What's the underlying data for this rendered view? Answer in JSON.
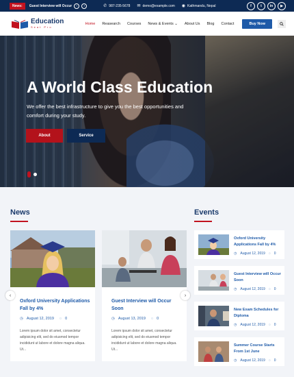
{
  "topbar": {
    "news_label": "News:",
    "ticker": "Guest Interview will Occur",
    "phone": "987-235-5678",
    "email": "demo@example.com",
    "location": "Kathmandu, Nepal"
  },
  "header": {
    "logo_title": "Education",
    "logo_sub": "Seat Pro",
    "nav": [
      "Home",
      "Reasearch",
      "Courses",
      "News & Events",
      "About Us",
      "Blog",
      "Contact"
    ],
    "buy_label": "Buy Now"
  },
  "hero": {
    "title": "A World Class Education",
    "text": "We offer the best infrastructure to give you the best opportunities and comfort during your study.",
    "about_label": "About",
    "service_label": "Service"
  },
  "news": {
    "title": "News",
    "items": [
      {
        "title": "Oxford University Applications Fall by 4%",
        "date": "August 12, 2019",
        "comments": "0",
        "desc": "Lorem ipsum dolor sit amet, consectetur adipisicing elit, sed do eiusmod tempor incididunt ut labore et dolore magna aliqua. Ut..."
      },
      {
        "title": "Guest Interview will Occur Soon",
        "date": "August 13, 2019",
        "comments": "0",
        "desc": "Lorem ipsum dolor sit amet, consectetur adipisicing elit, sed do eiusmod tempor incididunt ut labore et dolore magna aliqua. Ut..."
      }
    ]
  },
  "events": {
    "title": "Events",
    "items": [
      {
        "title": "Oxford University Applications Fall by 4%",
        "date": "August 12, 2019",
        "comments": "0"
      },
      {
        "title": "Guest Interview will Occur Soon",
        "date": "August 12, 2019",
        "comments": "0"
      },
      {
        "title": "New Exam Schedules for Diploma",
        "date": "August 12, 2019",
        "comments": "0"
      },
      {
        "title": "Summer Course Starts From 1st June",
        "date": "August 12, 2019",
        "comments": "0"
      }
    ]
  },
  "colors": {
    "navy": "#0d2a54",
    "red": "#c1121f",
    "blue": "#1e5aa8"
  }
}
